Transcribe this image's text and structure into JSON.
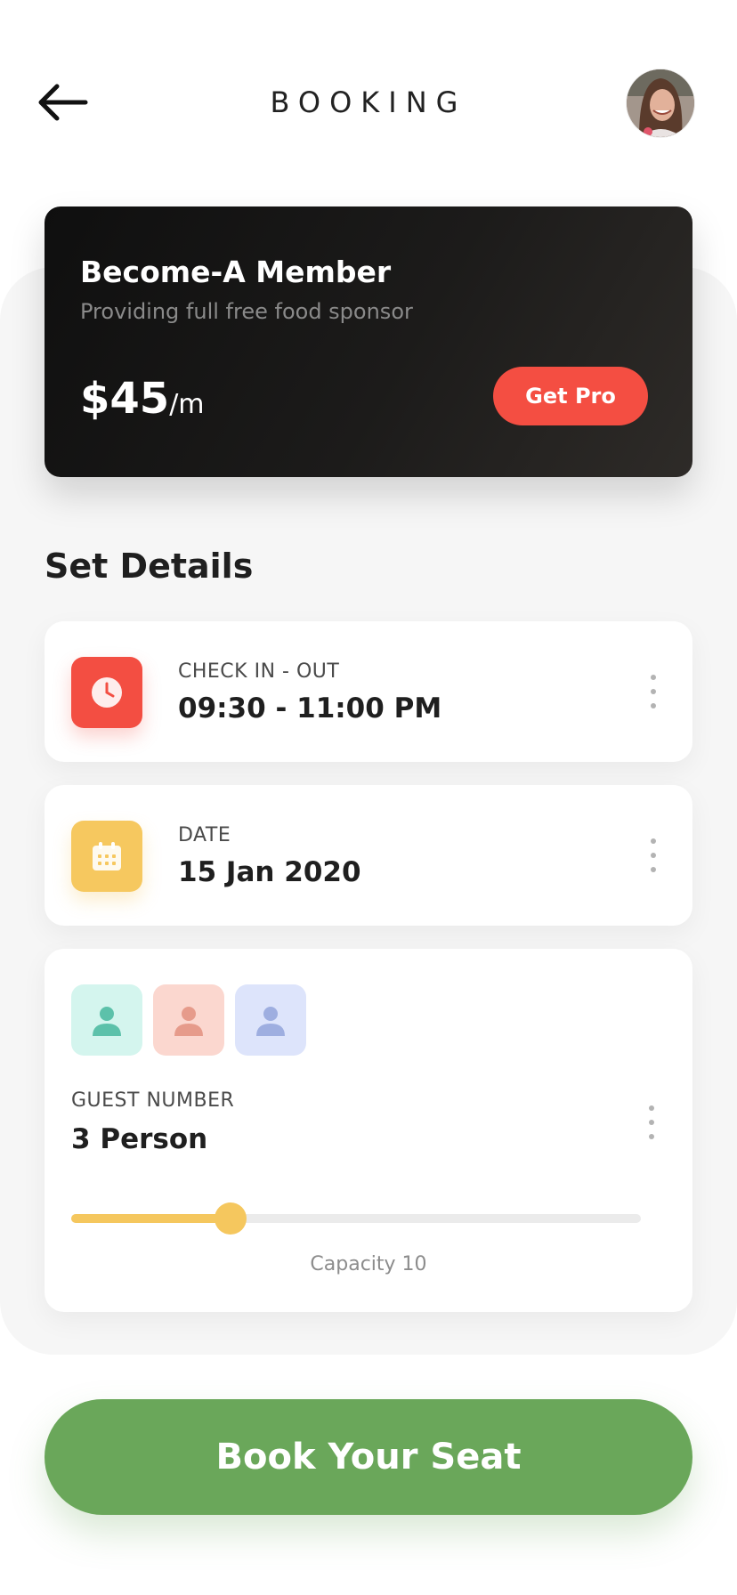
{
  "header": {
    "title": "BOOKING",
    "back_icon": "arrow-left-icon",
    "avatar": "user-avatar"
  },
  "membership": {
    "title": "Become-A Member",
    "subtitle": "Providing full free food sponsor",
    "price": "$45",
    "price_unit": "/m",
    "button_label": "Get Pro"
  },
  "section_title": "Set Details",
  "details": {
    "checkin": {
      "label": "CHECK IN - OUT",
      "value": "09:30 - 11:00 PM",
      "icon": "clock-icon",
      "icon_color": "#f34e42"
    },
    "date": {
      "label": "DATE",
      "value": "15 Jan 2020",
      "icon": "calendar-icon",
      "icon_color": "#f6c85f"
    },
    "guests": {
      "label": "GUEST NUMBER",
      "value": "3 Person",
      "capacity_label": "Capacity 10",
      "guest_icons": [
        "person-icon-teal",
        "person-icon-peach",
        "person-icon-blue"
      ],
      "slider_fraction": 0.28
    }
  },
  "cta": {
    "label": "Book Your Seat",
    "color": "#6aa75a"
  },
  "colors": {
    "accent_red": "#f44e42",
    "accent_yellow": "#f5c75e",
    "accent_green": "#6aa75a"
  }
}
